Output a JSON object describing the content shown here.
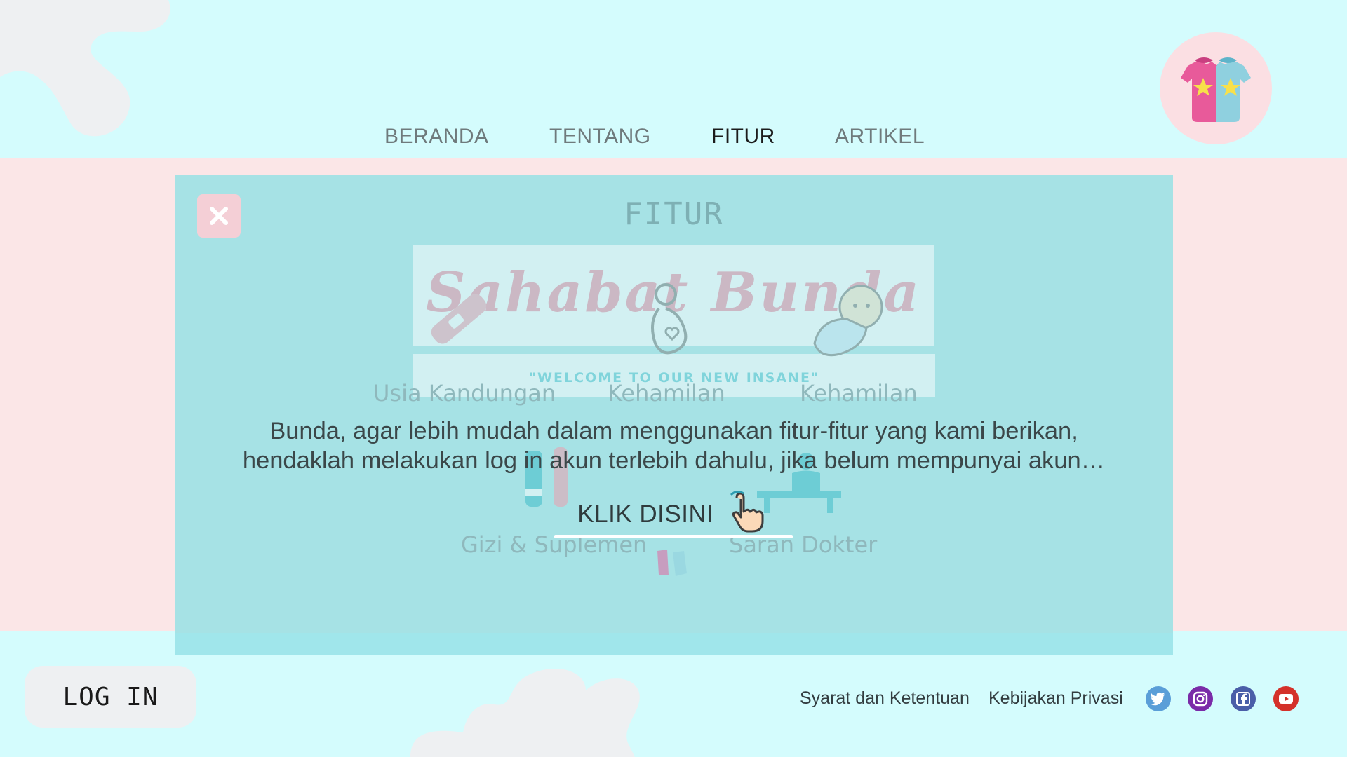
{
  "nav": {
    "items": [
      {
        "label": "BERANDA",
        "active": false
      },
      {
        "label": "TENTANG",
        "active": false
      },
      {
        "label": "FITUR",
        "active": true
      },
      {
        "label": "ARTIKEL",
        "active": false
      }
    ]
  },
  "modal": {
    "title": "FITUR",
    "banner_text": "Sahabat Bunda",
    "welcome_text": "\"WELCOME TO OUR NEW INSANE\"",
    "feature_labels": [
      "Usia Kandungan",
      "Kehamilan",
      "Kehamilan",
      "Gizi & Suplemen",
      "Saran Dokter"
    ],
    "message_line1": "Bunda, agar lebih mudah dalam menggunakan fitur-fitur yang kami berikan,",
    "message_line2": "hendaklah melakukan log in akun terlebih dahulu, jika belum mempunyai akun…",
    "cta_label": "KLIK DISINI"
  },
  "footer": {
    "login_label": "LOG IN",
    "terms_label": "Syarat dan Ketentuan",
    "privacy_label": "Kebijakan Privasi",
    "social": [
      "twitter-icon",
      "instagram-icon",
      "facebook-icon",
      "youtube-icon"
    ]
  },
  "colors": {
    "background": "#d4fcfd",
    "pink_band": "#fbe6e7",
    "modal": "#a6e2e5",
    "close_button": "#f4cfd6"
  }
}
